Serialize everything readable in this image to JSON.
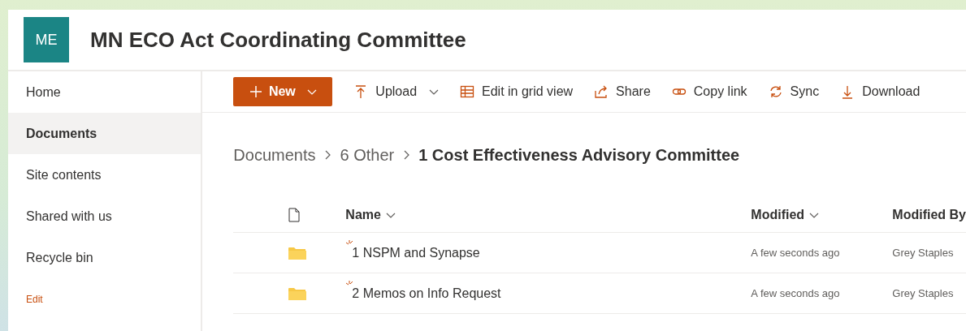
{
  "site": {
    "initials": "ME",
    "title": "MN ECO Act Coordinating Committee"
  },
  "nav": [
    {
      "label": "Home",
      "selected": false
    },
    {
      "label": "Documents",
      "selected": true
    },
    {
      "label": "Site contents",
      "selected": false
    },
    {
      "label": "Shared with us",
      "selected": false
    },
    {
      "label": "Recycle bin",
      "selected": false
    }
  ],
  "nav_edit": "Edit",
  "toolbar": [
    {
      "kind": "new",
      "label": "New"
    },
    {
      "kind": "upload",
      "label": "Upload"
    },
    {
      "kind": "grid",
      "label": "Edit in grid view"
    },
    {
      "kind": "share",
      "label": "Share"
    },
    {
      "kind": "link",
      "label": "Copy link"
    },
    {
      "kind": "sync",
      "label": "Sync"
    },
    {
      "kind": "download",
      "label": "Download"
    }
  ],
  "breadcrumb": [
    {
      "label": "Documents",
      "current": false
    },
    {
      "label": "6 Other",
      "current": false
    },
    {
      "label": "1 Cost Effectiveness Advisory Committee",
      "current": true
    }
  ],
  "table": {
    "columns": [
      "Name",
      "Modified",
      "Modified By"
    ],
    "rows": [
      {
        "name": "1 NSPM and Synapse",
        "modified": "A few seconds ago",
        "modified_by": "Grey Staples",
        "new": true
      },
      {
        "name": "2 Memos on Info Request",
        "modified": "A few seconds ago",
        "modified_by": "Grey Staples",
        "new": true
      }
    ]
  }
}
